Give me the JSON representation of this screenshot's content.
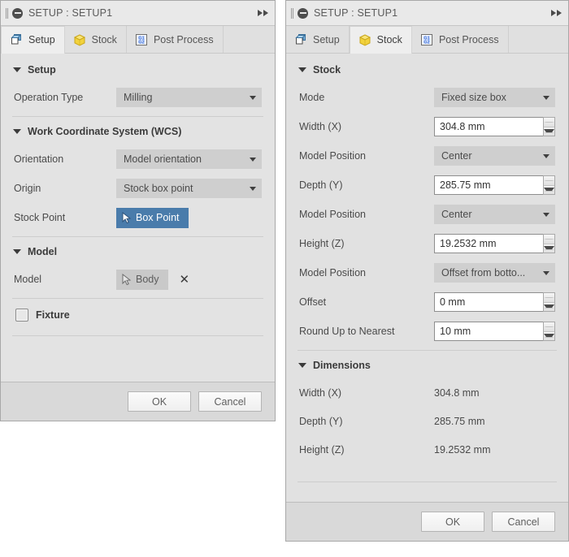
{
  "colors": {
    "panel_bg": "#e3e3e3",
    "titlebar_bg": "#e9e9e9",
    "combo_bg": "#cfcfcf",
    "accent_blue": "#4a7cab",
    "stock_icon_yellow": "#f2d23c",
    "post_icon_blue": "#2a5fd0",
    "footer_bg": "#d9d9d9"
  },
  "left_panel": {
    "title": "SETUP : SETUP1",
    "collapse_icon": "minus-circle-icon",
    "expand_icon": "double-right-arrow-icon",
    "tabs": [
      {
        "label": "Setup",
        "icon": "setup-cube-icon",
        "active": true
      },
      {
        "label": "Stock",
        "icon": "stock-cube-icon",
        "active": false
      },
      {
        "label": "Post Process",
        "icon": "g-code-icon",
        "active": false
      }
    ],
    "sections": [
      {
        "title": "Setup",
        "rows": [
          {
            "type": "combo",
            "label": "Operation Type",
            "value": "Milling"
          }
        ]
      },
      {
        "title": "Work Coordinate System (WCS)",
        "rows": [
          {
            "type": "combo",
            "label": "Orientation",
            "value": "Model orientation"
          },
          {
            "type": "combo",
            "label": "Origin",
            "value": "Stock box point"
          },
          {
            "type": "selbtn-primary",
            "label": "Stock Point",
            "value": "Box Point"
          }
        ]
      },
      {
        "title": "Model",
        "rows": [
          {
            "type": "selbtn-muted",
            "label": "Model",
            "value": "Body",
            "clear": "✕"
          }
        ]
      },
      {
        "title": "",
        "checkbox": {
          "label": "Fixture",
          "checked": false
        }
      }
    ],
    "footer": {
      "ok": "OK",
      "cancel": "Cancel"
    }
  },
  "right_panel": {
    "title": "SETUP : SETUP1",
    "collapse_icon": "minus-circle-icon",
    "expand_icon": "double-right-arrow-icon",
    "tabs": [
      {
        "label": "Setup",
        "icon": "setup-cube-icon",
        "active": false
      },
      {
        "label": "Stock",
        "icon": "stock-cube-icon",
        "active": true
      },
      {
        "label": "Post Process",
        "icon": "g-code-icon",
        "active": false
      }
    ],
    "stock_section": {
      "title": "Stock",
      "rows": [
        {
          "type": "combo",
          "label": "Mode",
          "value": "Fixed size box"
        },
        {
          "type": "spin",
          "label": "Width (X)",
          "value": "304.8 mm"
        },
        {
          "type": "combo",
          "label": "Model Position",
          "value": "Center"
        },
        {
          "type": "spin",
          "label": "Depth (Y)",
          "value": "285.75 mm"
        },
        {
          "type": "combo",
          "label": "Model Position",
          "value": "Center"
        },
        {
          "type": "spin",
          "label": "Height (Z)",
          "value": "19.2532 mm"
        },
        {
          "type": "combo",
          "label": "Model Position",
          "value": "Offset from botto..."
        },
        {
          "type": "spin",
          "label": "Offset",
          "value": "0 mm"
        },
        {
          "type": "spin",
          "label": "Round Up to Nearest",
          "value": "10 mm"
        }
      ]
    },
    "dimensions_section": {
      "title": "Dimensions",
      "rows": [
        {
          "label": "Width (X)",
          "value": "304.8 mm"
        },
        {
          "label": "Depth (Y)",
          "value": "285.75 mm"
        },
        {
          "label": "Height (Z)",
          "value": "19.2532 mm"
        }
      ]
    },
    "footer": {
      "ok": "OK",
      "cancel": "Cancel"
    }
  }
}
